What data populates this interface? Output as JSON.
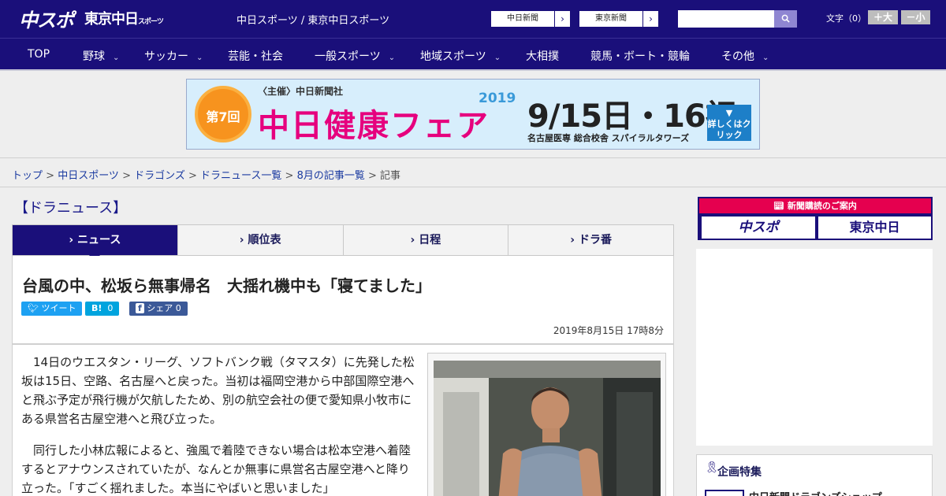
{
  "header": {
    "logo_main": "中スポ",
    "logo_sub": "東京中日",
    "logo_sub_small": "スポーツ",
    "site_title": "中日スポーツ / 東京中日スポーツ",
    "paper_links": [
      {
        "label": "中日新聞",
        "arrow": "›"
      },
      {
        "label": "東京新聞",
        "arrow": "›"
      }
    ],
    "search": {
      "placeholder": "",
      "button_icon": "search-icon"
    },
    "font_size": {
      "label": "文字（0）",
      "increase": "＋大",
      "decrease": "－小"
    }
  },
  "nav": {
    "items": [
      {
        "label": "TOP",
        "has_dropdown": false
      },
      {
        "label": "野球",
        "has_dropdown": true
      },
      {
        "label": "サッカー",
        "has_dropdown": true
      },
      {
        "label": "芸能・社会",
        "has_dropdown": false
      },
      {
        "label": "一般スポーツ",
        "has_dropdown": true
      },
      {
        "label": "地域スポーツ",
        "has_dropdown": true
      },
      {
        "label": "大相撲",
        "has_dropdown": false
      },
      {
        "label": "競馬・ボート・競輪",
        "has_dropdown": false
      },
      {
        "label": "その他",
        "has_dropdown": true
      }
    ],
    "chevron": "⌄"
  },
  "banner": {
    "badge": "第7回",
    "sponsor": "〈主催〉中日新聞社",
    "event": "中日健康フェア",
    "year": "2019",
    "dates": "9/15日・16祝",
    "venue": "名古屋医専 総合校舎 スパイラルタワーズ",
    "cta": "詳しくはクリック"
  },
  "breadcrumb": {
    "items": [
      "トップ",
      "中日スポーツ",
      "ドラゴンズ",
      "ドラニュース一覧",
      "8月の記事一覧"
    ],
    "current": "記事",
    "separator": " > "
  },
  "section": {
    "title": "【ドラニュース】"
  },
  "tabs": [
    {
      "label": "ニュース",
      "active": true
    },
    {
      "label": "順位表",
      "active": false
    },
    {
      "label": "日程",
      "active": false
    },
    {
      "label": "ドラ番",
      "active": false
    }
  ],
  "tab_marker": "›",
  "article": {
    "headline": "台風の中、松坂ら無事帰名　大揺れ機中も「寝てました」",
    "share": {
      "tweet": "ツイート",
      "hatena_label": "B!",
      "hatena_count": "0",
      "facebook_label": "シェア",
      "facebook_count": "0"
    },
    "date": "2019年8月15日 17時8分",
    "paragraphs": [
      "14日のウエスタン・リーグ、ソフトバンク戦（タマスタ）に先発した松坂は15日、空路、名古屋へと戻った。当初は福岡空港から中部国際空港へと飛ぶ予定が飛行機が欠航したため、別の航空会社の便で愛知県小牧市にある県営名古屋空港へと飛び立った。",
      "同行した小林広報によると、強風で着陸できない場合は松本空港へ着陸するとアナウンスされていたが、なんとか無事に県営名古屋空港へと降り立った。「すごく揺れました。本当にやばいと思いました」"
    ]
  },
  "sidebar": {
    "subscription": {
      "title": "新聞購読のご案内",
      "logo_1": "中スポ",
      "logo_2": "東京中日"
    },
    "feature": {
      "title": "企画特集",
      "first_item": "中日新聞ドラゴンズショップ"
    }
  },
  "colors": {
    "brand_navy": "#1a0f7a",
    "accent_pink": "#e5004f",
    "link_blue": "#1a3aa0"
  }
}
